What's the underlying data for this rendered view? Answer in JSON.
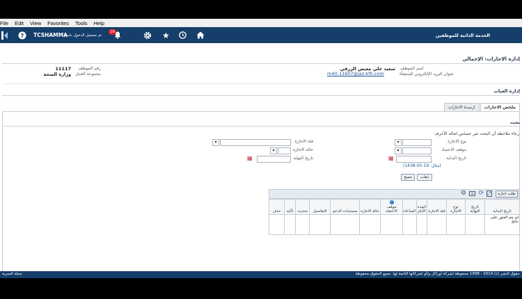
{
  "menu": {
    "items": [
      "File",
      "Edit",
      "View",
      "Favorites",
      "Tools",
      "Help"
    ]
  },
  "header": {
    "username": "TCSHAMMA",
    "logged_in_as": "تم تسجيل الدخول باسم",
    "notifications_count": "16",
    "app_title": "الخدمة الذاتية للموظفين"
  },
  "page": {
    "title": "إدارة الاجازات: الإجمالي",
    "employee_name_label": "اسم الموظف",
    "employee_name": "سعيد علي معيض الزرقي",
    "employee_number_label": "رقم الموظف",
    "employee_number": "11117",
    "email_label": "عنوان البريد الإلكتروني للمنشأة",
    "email": "m40-11607@jaz-kfh.com",
    "work_group_label": "مجموعة العمل",
    "work_group": "وزارة الصحة",
    "absence_section": "إدارة الغياب"
  },
  "tabs": [
    {
      "label": "ملخص الاجازات",
      "active": true
    },
    {
      "label": "ارصدة الاجازات",
      "active": false
    }
  ],
  "search": {
    "title": "بحث",
    "note": "رجاء ملاحظة أن البحث غير حساس لحالة الأحرف",
    "leave_type_label": "نوع الاجازة",
    "leave_category_label": "فئة الاجازة",
    "approval_status_label": "موقف الاعتماد",
    "leave_status_label": "حالة الاجازة",
    "start_date_label": "تاريخ البداية",
    "end_date_label": "تاريخ النهاية",
    "date_example": "(مثال: 19-05-1438)",
    "go_button": "ذهاب",
    "clear_button": "مسح"
  },
  "results": {
    "request_button": "طلب اجازة",
    "columns": [
      "تاريخ البداية",
      "تاريخ النهاية",
      "نوع الاجازة",
      "فئة الاجازة",
      "الأيام",
      "الساعات",
      "موقف الاعتماد",
      "حالة الاجازة",
      "مستندات الدعم",
      "التفاصيل",
      "تحديث",
      "تأكيد",
      "حذف"
    ],
    "duration_group": "المدة",
    "empty_message": "لم يتم العثور على نتائج"
  },
  "footer": {
    "copyright": "حقوق النشر (c) 1998 - 2014 محفوظة لشركة أوراكل و/أو لشركائها التابعة لها. جميع الحقوق محفوظة",
    "privacy": "جملة السرية"
  },
  "colors": {
    "brand": "#163e6b",
    "menubar": "#f0f0f0"
  }
}
